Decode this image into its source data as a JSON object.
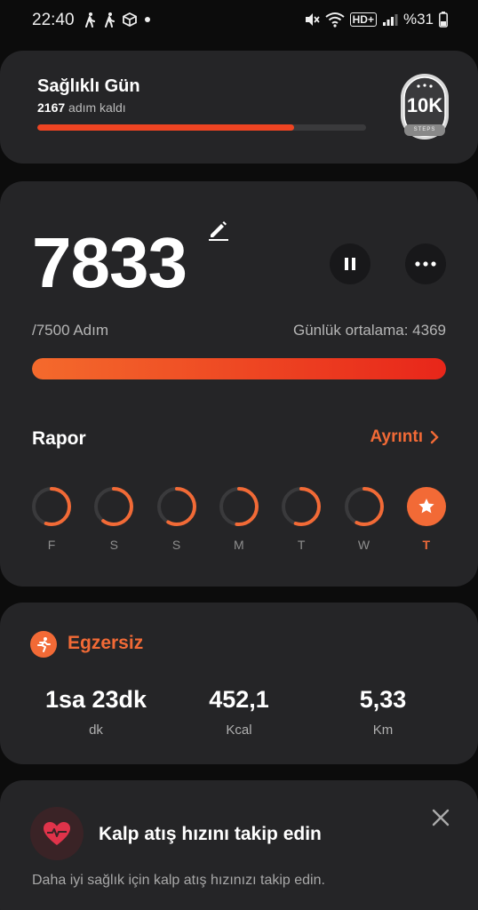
{
  "status_bar": {
    "time": "22:40",
    "battery_text": "%31",
    "network_label": "HD+"
  },
  "daily_goal": {
    "title": "Sağlıklı Gün",
    "remaining_value": "2167",
    "remaining_text": " adım kaldı",
    "progress_fraction": 0.78,
    "badge_label": "10K",
    "badge_sub": "STEPS"
  },
  "steps": {
    "count": "7833",
    "goal_text": "/7500 Adım",
    "average_text": "Günlük ortalama: 4369",
    "progress_fraction": 1.0
  },
  "report": {
    "title": "Rapor",
    "details_label": "Ayrıntı",
    "days": [
      {
        "label": "F",
        "progress": 0.55,
        "today": false
      },
      {
        "label": "S",
        "progress": 0.6,
        "today": false
      },
      {
        "label": "S",
        "progress": 0.58,
        "today": false
      },
      {
        "label": "M",
        "progress": 0.52,
        "today": false
      },
      {
        "label": "T",
        "progress": 0.55,
        "today": false
      },
      {
        "label": "W",
        "progress": 0.57,
        "today": false
      },
      {
        "label": "T",
        "progress": 1.0,
        "today": true
      }
    ]
  },
  "exercise": {
    "title": "Egzersiz",
    "stats": [
      {
        "value": "1sa 23dk",
        "unit": "dk"
      },
      {
        "value": "452,1",
        "unit": "Kcal"
      },
      {
        "value": "5,33",
        "unit": "Km"
      }
    ]
  },
  "heart_rate": {
    "title": "Kalp atış hızını takip edin",
    "description": "Daha iyi sağlık için kalp atış hızınızı takip edin."
  },
  "colors": {
    "accent": "#f26a36",
    "card_bg": "#252527",
    "track": "#3a3a3c"
  }
}
